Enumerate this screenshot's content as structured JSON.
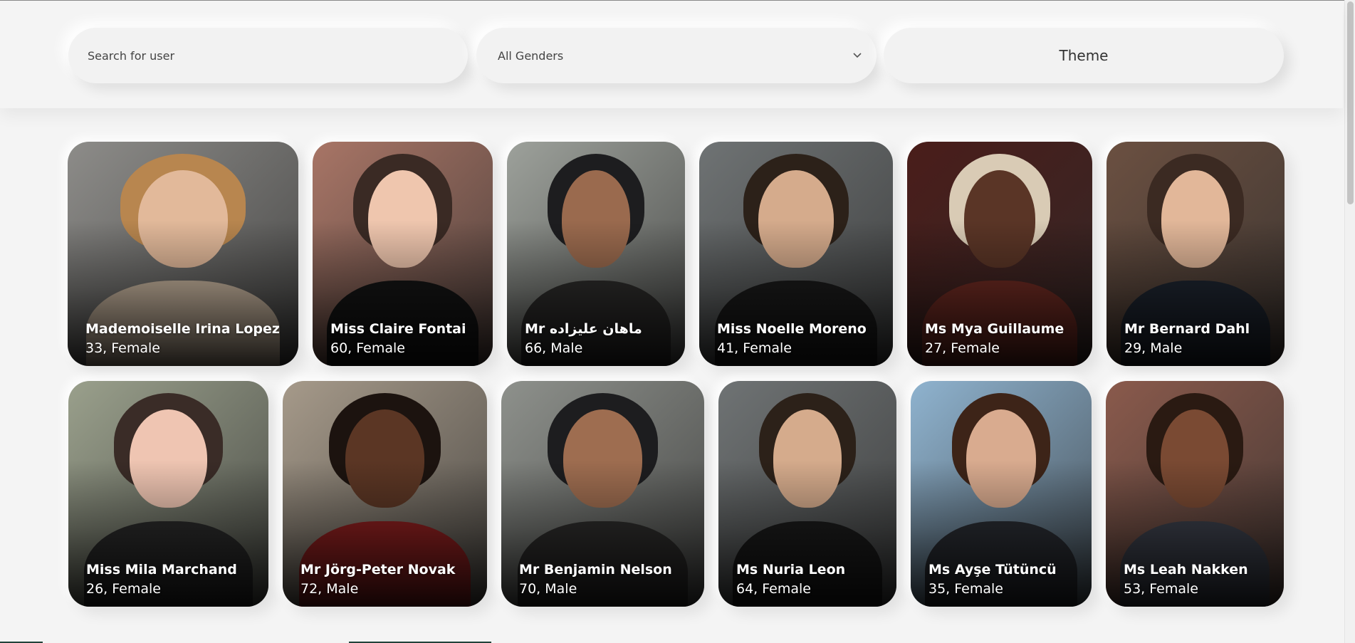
{
  "filters": {
    "search_placeholder": "Search for user",
    "gender_selected": "All Genders",
    "theme_label": "Theme"
  },
  "users": [
    {
      "name": "Mademoiselle Irina Lopez",
      "meta": "33, Female",
      "photo": {
        "bg": "#8d8c89",
        "skin": "#e2b99a",
        "hair": "#b8864f",
        "shirt": "#c7b49e"
      }
    },
    {
      "name": "Miss Claire Fontai",
      "meta": "60, Female",
      "photo": {
        "bg": "#a87566",
        "skin": "#efc6ae",
        "hair": "#3a2a24",
        "shirt": "#151515"
      }
    },
    {
      "name": "Mr ماهان علیزاده",
      "meta": "66, Male",
      "photo": {
        "bg": "#9da19b",
        "skin": "#9a6a4e",
        "hair": "#1d1d1f",
        "shirt": "#2d2c2b"
      }
    },
    {
      "name": "Miss Noelle Moreno",
      "meta": "41, Female",
      "photo": {
        "bg": "#6f7374",
        "skin": "#d5ab8c",
        "hair": "#2c2119",
        "shirt": "#1b1b1b"
      }
    },
    {
      "name": "Ms Mya Guillaume",
      "meta": "27, Female",
      "photo": {
        "bg": "#4a1d1a",
        "skin": "#5a3526",
        "hair": "#d9cbb5",
        "shirt": "#6d2a22"
      }
    },
    {
      "name": "Mr Bernard Dahl",
      "meta": "29, Male",
      "photo": {
        "bg": "#6b5041",
        "skin": "#e2b799",
        "hair": "#3b2a22",
        "shirt": "#1e2530"
      }
    },
    {
      "name": "Miss Mila Marchand",
      "meta": "26, Female",
      "photo": {
        "bg": "#9aa08c",
        "skin": "#efc5b2",
        "hair": "#3a2c27",
        "shirt": "#2a2a2a"
      }
    },
    {
      "name": "Mr Jörg-Peter Novak",
      "meta": "72, Male",
      "photo": {
        "bg": "#a69a8a",
        "skin": "#5b3624",
        "hair": "#1c130f",
        "shirt": "#8b1f1f"
      }
    },
    {
      "name": "Mr Benjamin Nelson",
      "meta": "70, Male",
      "photo": {
        "bg": "#8e918c",
        "skin": "#9e6d50",
        "hair": "#1d1d1f",
        "shirt": "#2d2c2b"
      }
    },
    {
      "name": "Ms Nuria Leon",
      "meta": "64, Female",
      "photo": {
        "bg": "#6f7374",
        "skin": "#d5ab8c",
        "hair": "#2c2119",
        "shirt": "#1b1b1b"
      }
    },
    {
      "name": "Ms Ayşe Tütüncü",
      "meta": "35, Female",
      "photo": {
        "bg": "#8fb3cf",
        "skin": "#d9ab8f",
        "hair": "#3d2418",
        "shirt": "#2a2d33"
      }
    },
    {
      "name": "Ms Leah Nakken",
      "meta": "53, Female",
      "photo": {
        "bg": "#8a5a4c",
        "skin": "#7a4a33",
        "hair": "#2a1a12",
        "shirt": "#3b3f4a"
      }
    }
  ]
}
